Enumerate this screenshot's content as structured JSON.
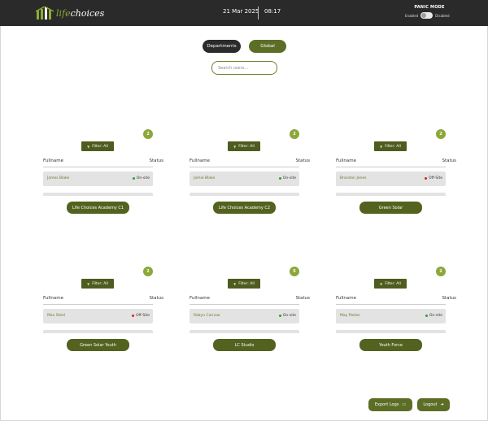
{
  "header": {
    "logo_life": "life",
    "logo_choices": "choices",
    "date": "21 Mar 2025",
    "time": "08:17",
    "panic_mode": {
      "title": "PANIC MODE",
      "enabled_label": "Enabled",
      "disabled_label": "Disabled"
    }
  },
  "view_toggle": {
    "departments": "Departments",
    "global": "Global"
  },
  "search": {
    "placeholder": "Search users..."
  },
  "departments": [
    {
      "name": "Life Choices Academy C1",
      "count": "2",
      "filter_label": "Filter: All",
      "fullname_header": "Fullname",
      "status_header": "Status",
      "user": "James Blake",
      "status": "On-site",
      "status_color": "#2e9e2e"
    },
    {
      "name": "Life Choices Academy C2",
      "count": "2",
      "filter_label": "Filter: All",
      "fullname_header": "Fullname",
      "status_header": "Status",
      "user": "Jamie Blake",
      "status": "On-site",
      "status_color": "#2e9e2e"
    },
    {
      "name": "Green Solar",
      "count": "2",
      "filter_label": "Filter: All",
      "fullname_header": "Fullname",
      "status_header": "Status",
      "user": "Brandon Jones",
      "status": "Off-Site",
      "status_color": "#e02020"
    },
    {
      "name": "Green Solar Youth",
      "count": "2",
      "filter_label": "Filter: All",
      "fullname_header": "Fullname",
      "status_header": "Status",
      "user": "Max Steel",
      "status": "Off-Site",
      "status_color": "#e02020"
    },
    {
      "name": "LC Studio",
      "count": "5",
      "filter_label": "Filter: All",
      "fullname_header": "Fullname",
      "status_header": "Status",
      "user": "Robyn Carnow",
      "status": "On-site",
      "status_color": "#2e9e2e"
    },
    {
      "name": "Youth Force",
      "count": "2",
      "filter_label": "Filter: All",
      "fullname_header": "Fullname",
      "status_header": "Status",
      "user": "May Parker",
      "status": "On-site",
      "status_color": "#2e9e2e"
    }
  ],
  "footer": {
    "export_label": "Export Logs",
    "export_icon": "calendar-icon",
    "logout_label": "Logout",
    "logout_icon": "logout-icon"
  },
  "colors": {
    "header_bg": "#2a2a2a",
    "accent_green": "#5c6e26",
    "badge_green": "#8ca738",
    "on_site": "#2e9e2e",
    "off_site": "#e02020"
  }
}
